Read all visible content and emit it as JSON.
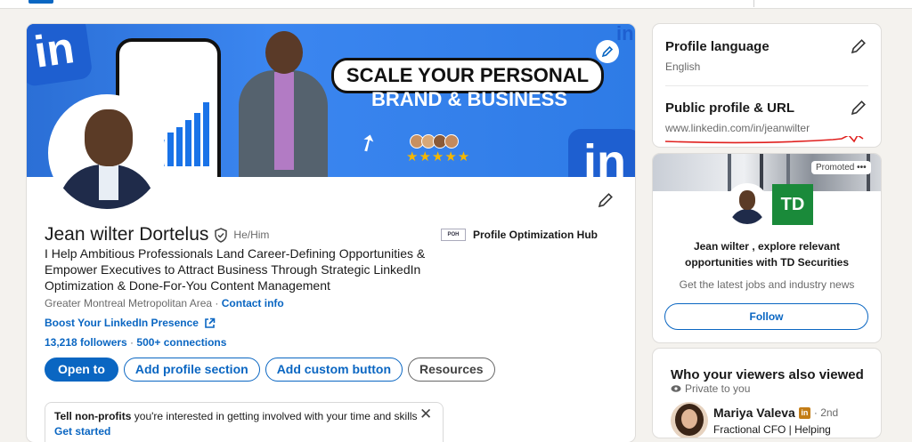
{
  "profile": {
    "name": "Jean wilter Dortelus",
    "pronouns": "He/Him",
    "headline": "I Help Ambitious Professionals Land Career-Defining Opportunities & Empower Executives to Attract Business Through Strategic LinkedIn Optimization & Done-For-You Content Management",
    "location": "Greater Montreal Metropolitan Area",
    "location_separator": " · ",
    "contact_info": "Contact info",
    "website_label": "Boost Your LinkedIn Presence",
    "followers": "13,218 followers",
    "stats_separator": " · ",
    "connections": "500+ connections",
    "company": "Profile Optimization Hub",
    "company_logo_text": "POH",
    "banner": {
      "in_logo": "in",
      "headline_top": "SCALE YOUR PERSONAL",
      "headline_bottom": "BRAND & BUSINESS",
      "stars": "★★★★★"
    },
    "actions": {
      "open_to": "Open to",
      "add_profile_section": "Add profile section",
      "add_custom_button": "Add custom button",
      "resources": "Resources"
    },
    "nonprofit_prompt": {
      "bold": "Tell non-profits",
      "rest": " you're interested in getting involved with your time and skills",
      "cta": "Get started",
      "close": "✕"
    }
  },
  "sidebar": {
    "profile_language_title": "Profile language",
    "profile_language_value": "English",
    "public_profile_title": "Public profile & URL",
    "public_profile_url": "www.linkedin.com/in/jeanwilter"
  },
  "ad": {
    "promoted": "Promoted",
    "more": "•••",
    "brand_logo": "TD",
    "message_line1": "Jean wilter , explore relevant",
    "message_line2": "opportunities with TD Securities",
    "subtext": "Get the latest jobs and industry news",
    "follow": "Follow"
  },
  "viewers": {
    "title": "Who your viewers also viewed",
    "private": "Private to you",
    "person_name": "Mariya Valeva",
    "badge": "in",
    "degree": "· 2nd",
    "headline": "Fractional CFO | Helping"
  },
  "colors": {
    "accent": "#0a66c2",
    "background": "#f4f2ee",
    "annotation_red": "#e0201e",
    "td_green": "#1a8a3a"
  }
}
